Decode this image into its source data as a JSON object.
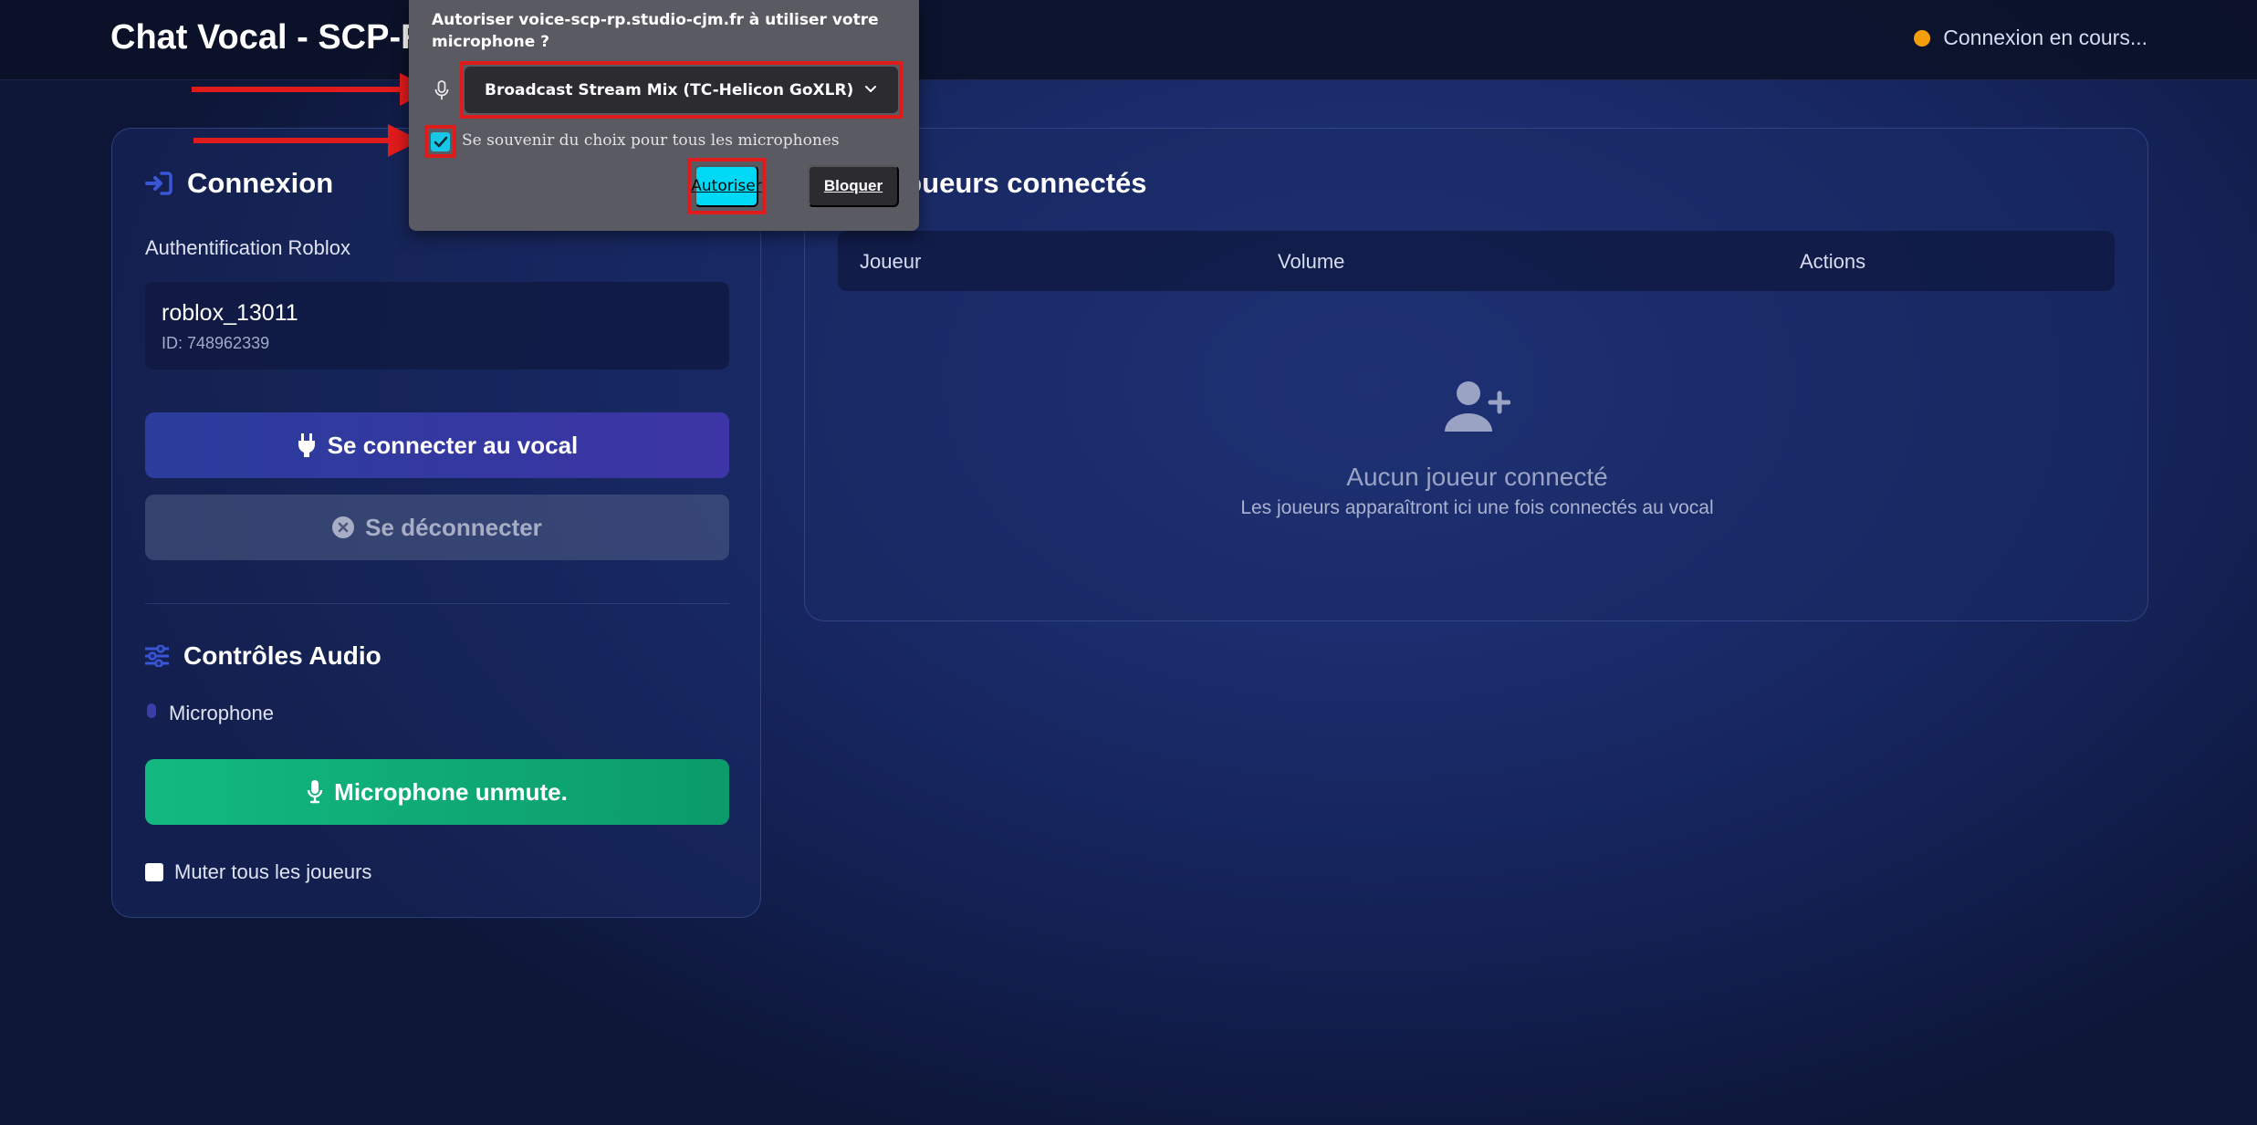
{
  "header": {
    "title": "Chat Vocal - SCP-RP",
    "status_text": "Connexion en cours...",
    "status_color": "#f59e0b"
  },
  "login_card": {
    "heading": "Connexion",
    "auth_label": "Authentification Roblox",
    "username": "roblox_13011",
    "user_id": "ID: 748962339",
    "connect_label": "Se connecter au vocal",
    "disconnect_label": "Se déconnecter"
  },
  "audio": {
    "heading": "Contrôles Audio",
    "mic_label": "Microphone",
    "mic_button_label": "Microphone unmute.",
    "mute_all_label": "Muter tous les joueurs",
    "mute_all_checked": false
  },
  "players_card": {
    "heading": "Joueurs connectés",
    "columns": [
      "Joueur",
      "Volume",
      "Actions"
    ],
    "empty_title": "Aucun joueur connecté",
    "empty_subtitle": "Les joueurs apparaîtront ici une fois connectés au vocal"
  },
  "permission_popup": {
    "title": "Autoriser voice-scp-rp.studio-cjm.fr à utiliser votre microphone ?",
    "device": "Broadcast Stream Mix (TC-Helicon GoXLR)",
    "remember_label": "Se souvenir du choix pour tous les microphones",
    "remember_checked": true,
    "allow_label": "Autoriser",
    "block_label": "Bloquer"
  },
  "colors": {
    "accent": "#3d35a5",
    "success": "#12b981",
    "highlight": "#e01b1b",
    "allow": "#00d9f5"
  }
}
